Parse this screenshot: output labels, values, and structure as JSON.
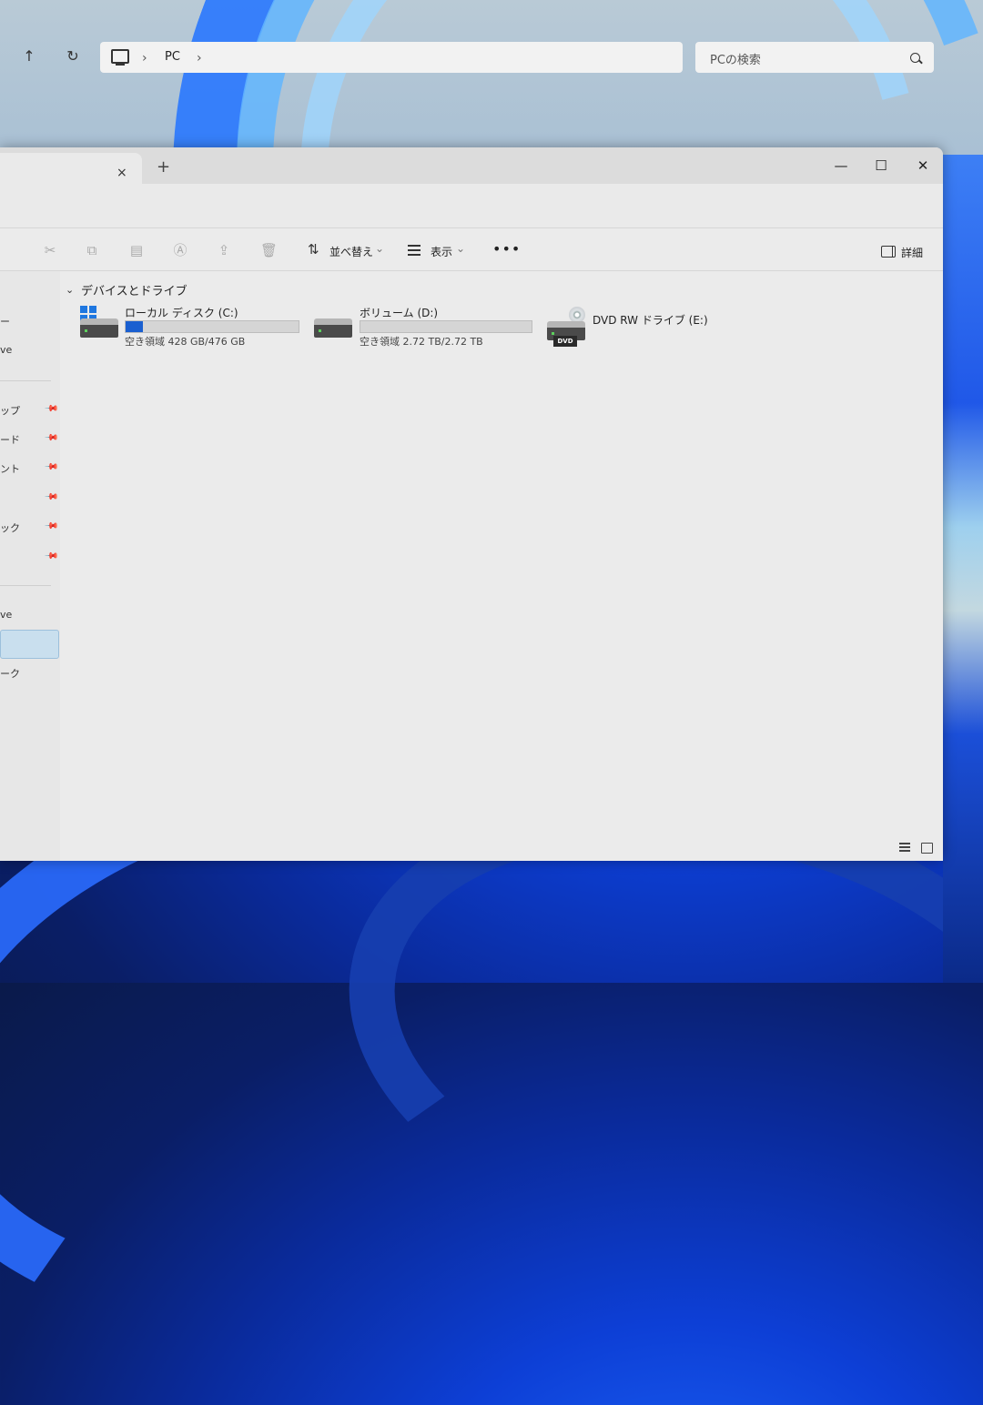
{
  "window": {
    "tab_close": "×",
    "tab_add": "+",
    "minimize": "—",
    "maximize": "☐",
    "close": "✕"
  },
  "address": {
    "back": "↑",
    "refresh": "↻",
    "breadcrumb": [
      "PC"
    ],
    "search_placeholder": "PCの検索"
  },
  "toolbar": {
    "sort_label": "並べ替え",
    "view_label": "表示",
    "more_label": "•••",
    "details_label": "詳細"
  },
  "sidebar": {
    "items": [
      {
        "label": "ー"
      },
      {
        "label": "ve"
      },
      {
        "label": "ップ"
      },
      {
        "label": "ード"
      },
      {
        "label": "ント"
      },
      {
        "label": ""
      },
      {
        "label": "ック"
      },
      {
        "label": ""
      },
      {
        "label": "ve"
      },
      {
        "label": "ーク"
      }
    ]
  },
  "main": {
    "section_title": "デバイスとドライブ",
    "drives": [
      {
        "name": "ローカル ディスク (C:)",
        "free": "空き領域 428 GB/476 GB",
        "used_fraction": 0.1
      },
      {
        "name": "ボリューム (D:)",
        "free": "空き領域 2.72 TB/2.72 TB",
        "used_fraction": 0.0
      },
      {
        "name": "DVD RW ドライブ (E:)",
        "dvd_tag": "DVD"
      }
    ]
  },
  "colors": {
    "accent": "#1a5fd0",
    "window_bg": "#ebebeb",
    "selected": "#c9dfee"
  }
}
